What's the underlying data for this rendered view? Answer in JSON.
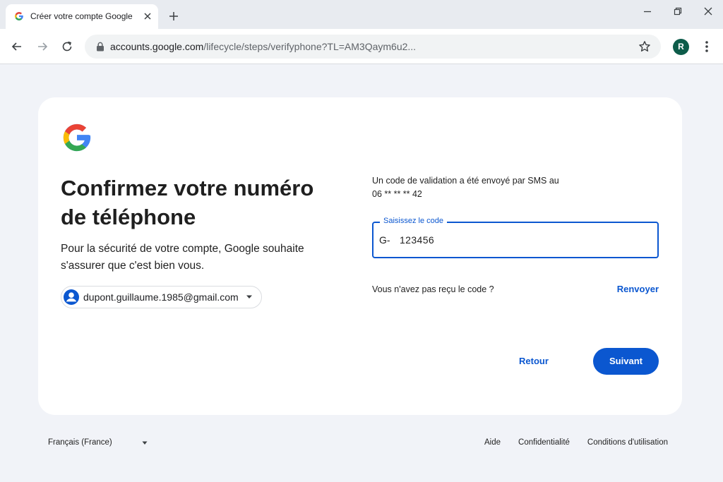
{
  "browser": {
    "tab_title": "Créer votre compte Google",
    "url_host": "accounts.google.com",
    "url_path": "/lifecycle/steps/verifyphone?TL=AM3Qaym6u2...",
    "profile_initial": "R"
  },
  "card": {
    "heading": "Confirmez votre numéro de téléphone",
    "subtitle": "Pour la sécurité de votre compte, Google souhaite s'assurer que c'est bien vous.",
    "account_email": "dupont.guillaume.1985@gmail.com",
    "sms_info_line1": "Un code de validation a été envoyé par SMS au",
    "sms_info_line2": "06 ** ** ** 42",
    "code_field": {
      "label": "Saisissez le code",
      "prefix": "G-",
      "value": "123456"
    },
    "resend_question": "Vous n'avez pas reçu le code ?",
    "resend_link": "Renvoyer",
    "back_label": "Retour",
    "next_label": "Suivant"
  },
  "footer": {
    "language": "Français (France)",
    "links": [
      "Aide",
      "Confidentialité",
      "Conditions d'utilisation"
    ]
  },
  "colors": {
    "accent": "#0b57d0",
    "page_bg": "#f1f3f8",
    "avatar_bg": "#0d5c4a"
  }
}
